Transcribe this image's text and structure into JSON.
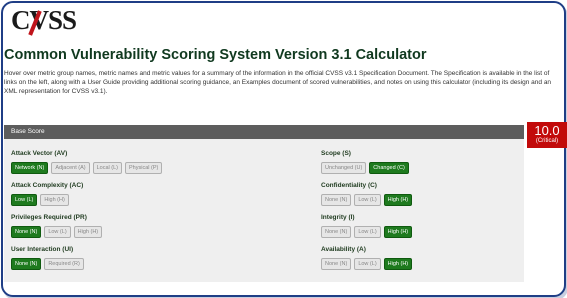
{
  "logo": {
    "text": "CVSS"
  },
  "page": {
    "title": "Common Vulnerability Scoring System Version 3.1 Calculator",
    "description": "Hover over metric group names, metric names and metric values for a summary of the information in the official CVSS v3.1 Specification Document. The Specification is available in the list of links on the left, along with a User Guide providing additional scoring guidance, an Examples document of scored vulnerabilities, and notes on using this calculator (including its design and an XML representation for CVSS v3.1)."
  },
  "base_score": {
    "label": "Base Score",
    "score": "10.0",
    "severity": "(Critical)"
  },
  "colors": {
    "selected": "#1e7a1e",
    "critical": "#c20a0a",
    "header": "#5d5d5d"
  },
  "metrics": {
    "av": {
      "label": "Attack Vector (AV)",
      "options": [
        "Network (N)",
        "Adjacent (A)",
        "Local (L)",
        "Physical (P)"
      ],
      "selected": "Network (N)"
    },
    "ac": {
      "label": "Attack Complexity (AC)",
      "options": [
        "Low (L)",
        "High (H)"
      ],
      "selected": "Low (L)"
    },
    "pr": {
      "label": "Privileges Required (PR)",
      "options": [
        "None (N)",
        "Low (L)",
        "High (H)"
      ],
      "selected": "None (N)"
    },
    "ui": {
      "label": "User Interaction (UI)",
      "options": [
        "None (N)",
        "Required (R)"
      ],
      "selected": "None (N)"
    },
    "s": {
      "label": "Scope (S)",
      "options": [
        "Unchanged (U)",
        "Changed (C)"
      ],
      "selected": "Changed (C)"
    },
    "c": {
      "label": "Confidentiality (C)",
      "options": [
        "None (N)",
        "Low (L)",
        "High (H)"
      ],
      "selected": "High (H)"
    },
    "i": {
      "label": "Integrity (I)",
      "options": [
        "None (N)",
        "Low (L)",
        "High (H)"
      ],
      "selected": "High (H)"
    },
    "a": {
      "label": "Availability (A)",
      "options": [
        "None (N)",
        "Low (L)",
        "High (H)"
      ],
      "selected": "High (H)"
    }
  }
}
